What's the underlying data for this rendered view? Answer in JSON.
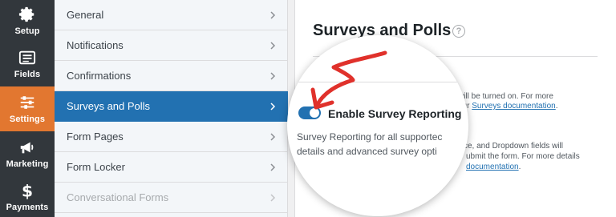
{
  "rail": {
    "items": [
      {
        "label": "Setup",
        "icon": "gear-icon"
      },
      {
        "label": "Fields",
        "icon": "fields-icon"
      },
      {
        "label": "Settings",
        "icon": "sliders-icon",
        "active": true
      },
      {
        "label": "Marketing",
        "icon": "megaphone-icon"
      },
      {
        "label": "Payments",
        "icon": "dollar-icon"
      }
    ]
  },
  "nav": {
    "items": [
      {
        "label": "General"
      },
      {
        "label": "Notifications"
      },
      {
        "label": "Confirmations"
      },
      {
        "label": "Surveys and Polls",
        "active": true
      },
      {
        "label": "Form Pages"
      },
      {
        "label": "Form Locker"
      },
      {
        "label": "Conversational Forms",
        "muted": true
      }
    ]
  },
  "panel": {
    "title": "Surveys and Polls",
    "help": "?",
    "bg_line1": "will be turned on. For more",
    "bg_line2_prefix": "our ",
    "bg_line2_link": "Surveys documentation",
    "bg_line2_suffix": ".",
    "bg_line3": "ce, and Dropdown fields will",
    "bg_line4": "ubmit the form. For more details",
    "bg_line5_link": "documentation",
    "bg_line5_suffix": "."
  },
  "lens": {
    "toggle_label": "Enable Survey Reporting",
    "toggle_state": "on",
    "line1": "Survey Reporting for all supportec",
    "line2": "details and advanced survey opti"
  },
  "colors": {
    "rail_bg": "#32373c",
    "rail_active": "#e27730",
    "nav_active": "#2271b1",
    "toggle_on": "#2271b1",
    "arrow": "#e0312b"
  }
}
